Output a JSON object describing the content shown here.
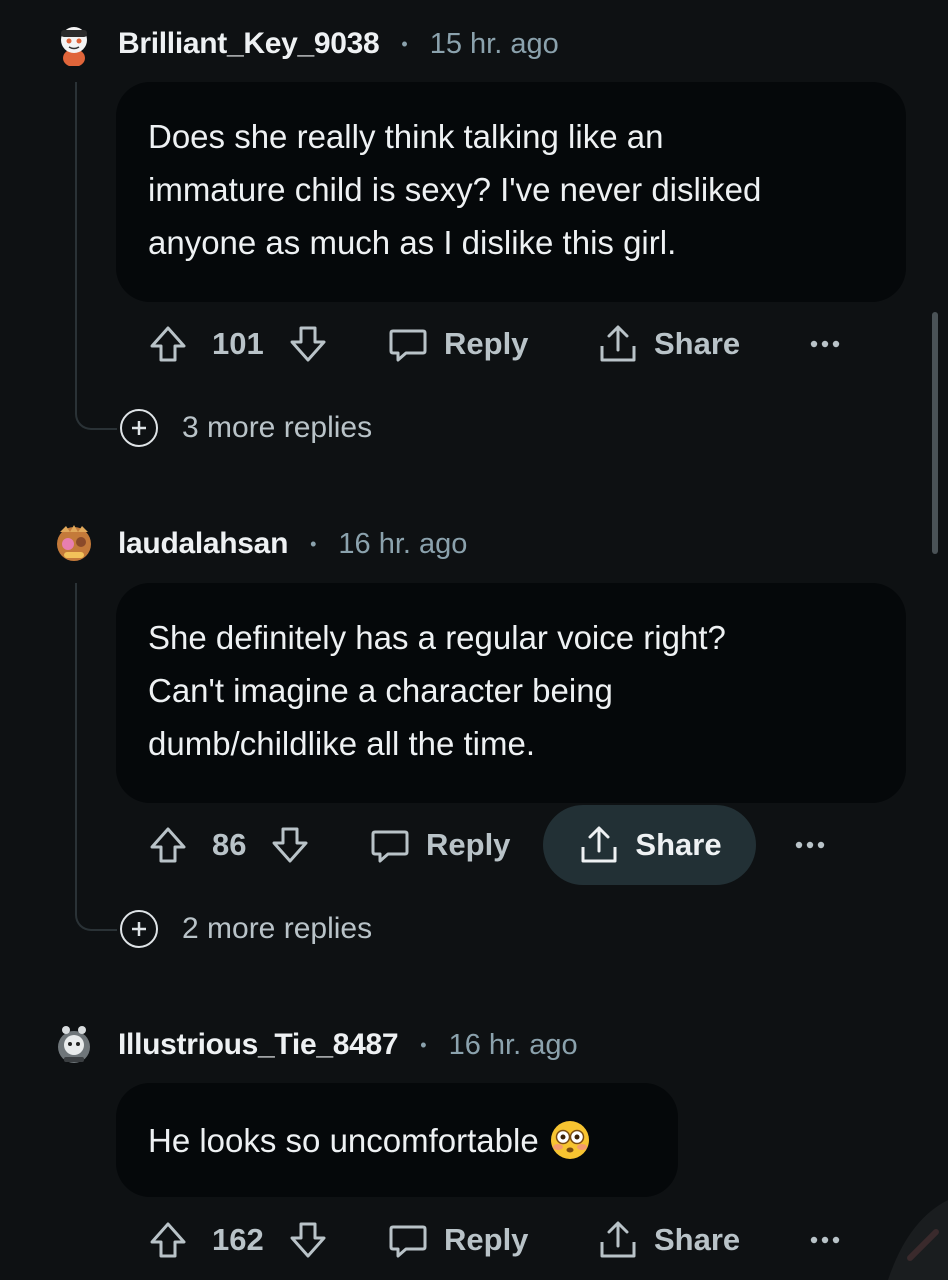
{
  "comments": [
    {
      "username": "Brilliant_Key_9038",
      "time": "15 hr. ago",
      "body": [
        "Does she really think talking like an",
        "immature child is sexy? I've never disliked",
        "anyone as much as I dislike this girl."
      ],
      "votes": "101",
      "reply_label": "Reply",
      "share_label": "Share",
      "more_replies": "3 more replies"
    },
    {
      "username": "laudalahsan",
      "time": "16 hr. ago",
      "body": [
        "She definitely has a regular voice right?",
        "Can't imagine a character being",
        "dumb/childlike all the time."
      ],
      "votes": "86",
      "reply_label": "Reply",
      "share_label": "Share",
      "more_replies": "2 more replies"
    },
    {
      "username": "Illustrious_Tie_8487",
      "time": "16 hr. ago",
      "body": [
        "He looks so uncomfortable"
      ],
      "emoji": "flushed-face-emoji",
      "votes": "162",
      "reply_label": "Reply",
      "share_label": "Share"
    }
  ],
  "separator": "•",
  "colors": {
    "background": "#0e1113",
    "bubble": "#05080a",
    "muted": "#8ba2ad",
    "action": "#b9c3c8",
    "share_highlight": "#223035"
  }
}
